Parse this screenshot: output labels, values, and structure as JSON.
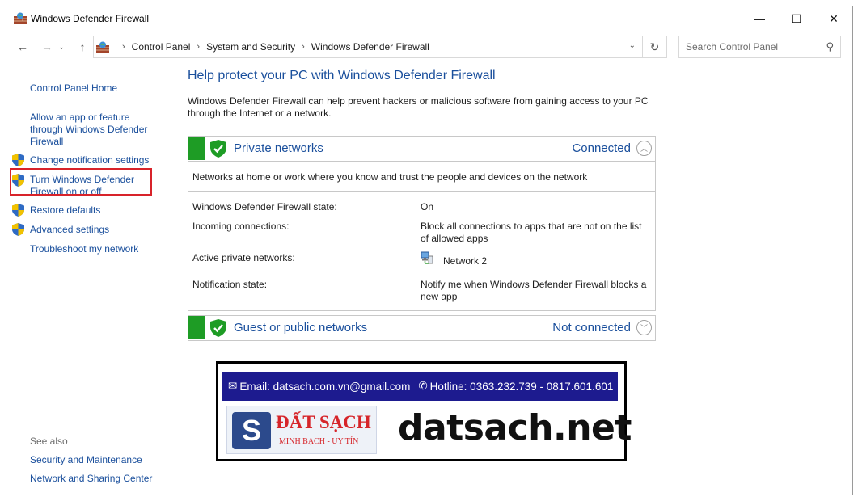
{
  "window": {
    "title": "Windows Defender Firewall",
    "controls": {
      "minimize": "—",
      "maximize": "☐",
      "close": "✕"
    }
  },
  "address_bar": {
    "crumbs": [
      "Control Panel",
      "System and Security",
      "Windows Defender Firewall"
    ],
    "search_placeholder": "Search Control Panel"
  },
  "left_pane": {
    "home": "Control Panel Home",
    "allow_app": [
      "Allow an app or feature",
      "through Windows Defender",
      "Firewall"
    ],
    "change_notification": "Change notification settings",
    "turn_on_off": [
      "Turn Windows Defender",
      "Firewall on or off"
    ],
    "restore_defaults": "Restore defaults",
    "advanced_settings": "Advanced settings",
    "troubleshoot": "Troubleshoot my network",
    "see_also": {
      "heading": "See also",
      "items": [
        "Security and Maintenance",
        "Network and Sharing Center"
      ]
    }
  },
  "main": {
    "heading": "Help protect your PC with Windows Defender Firewall",
    "intro": [
      "Windows Defender Firewall can help prevent hackers or malicious software from gaining access to your PC",
      "through the Internet or a network."
    ],
    "private": {
      "title": "Private networks",
      "status": "Connected",
      "description": "Networks at home or work where you know and trust the people and devices on the network",
      "rows": [
        {
          "label": "Windows Defender Firewall state:",
          "value": "On"
        },
        {
          "label": "Incoming connections:",
          "value": [
            "Block all connections to apps that are not on the list",
            "of allowed apps"
          ]
        },
        {
          "label": "Active private networks:",
          "value": "Network 2"
        },
        {
          "label": "Notification state:",
          "value": [
            "Notify me when Windows Defender Firewall blocks a",
            "new app"
          ]
        }
      ]
    },
    "guest": {
      "title": "Guest or public networks",
      "status": "Not connected"
    }
  },
  "banner": {
    "email": "Email: datsach.com.vn@gmail.com",
    "hotline": "Hotline: 0363.232.739 - 0817.601.601",
    "logo_letter": "S",
    "logo_brand": "ĐẤT SẠCH",
    "logo_tagline": "MINH BẠCH - UY TÍN",
    "site": "datsach.net"
  },
  "colors": {
    "link": "#1a4f9c",
    "firewall_green": "#1e9c25",
    "highlight_red": "#d8232a",
    "banner_navy": "#1d1b8f"
  },
  "icons": [
    "firewall-app-icon",
    "back-arrow-icon",
    "forward-arrow-icon",
    "up-arrow-icon",
    "refresh-icon",
    "search-icon",
    "uac-shield-icon",
    "green-check-shield-icon",
    "chevron-up-icon",
    "chevron-down-icon",
    "network-icon",
    "envelope-icon",
    "phone-icon"
  ]
}
